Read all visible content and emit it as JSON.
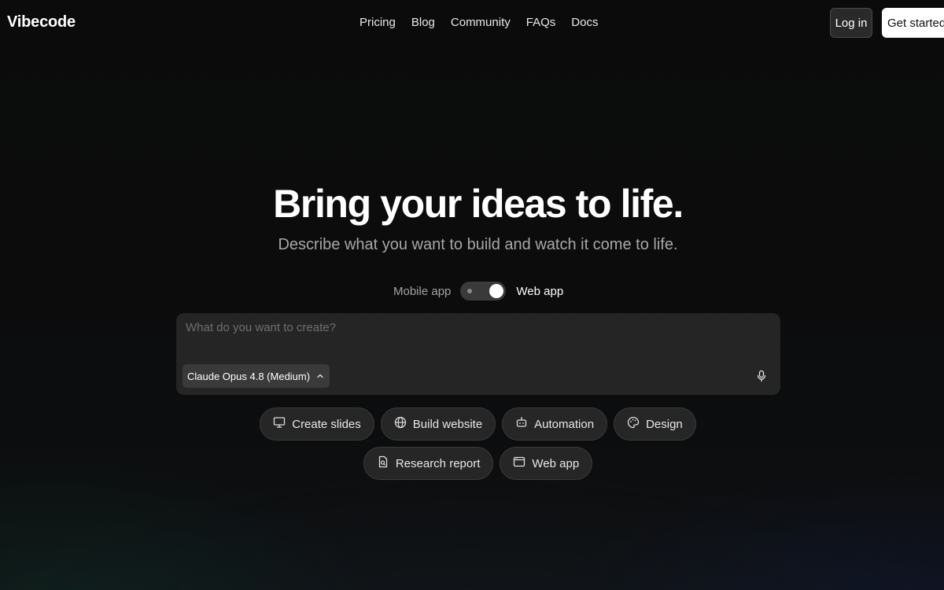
{
  "header": {
    "brand": "Vibecode",
    "nav": [
      "Pricing",
      "Blog",
      "Community",
      "FAQs",
      "Docs"
    ],
    "login_label": "Log in",
    "get_started_label": "Get started"
  },
  "hero": {
    "title": "Bring your ideas to life.",
    "subtitle": "Describe what you want to build and watch it come to life."
  },
  "mode_toggle": {
    "left_label": "Mobile app",
    "right_label": "Web app",
    "selected": "Web app"
  },
  "prompt": {
    "placeholder": "What do you want to create?",
    "value": "",
    "model": "Claude Opus 4.8 (Medium)",
    "model_icon": "chevron-up-icon",
    "mic_icon": "microphone-icon"
  },
  "chips": {
    "row1": [
      {
        "label": "Create slides",
        "icon": "presentation-icon"
      },
      {
        "label": "Build website",
        "icon": "globe-icon"
      },
      {
        "label": "Automation",
        "icon": "robot-icon"
      },
      {
        "label": "Design",
        "icon": "palette-icon"
      }
    ],
    "row2": [
      {
        "label": "Research report",
        "icon": "file-search-icon"
      },
      {
        "label": "Web app",
        "icon": "browser-window-icon"
      }
    ]
  },
  "colors": {
    "background": "#0b0b0b",
    "surface": "#252525",
    "chip_bg": "#262626",
    "primary_button": "#ffffff",
    "muted_text": "#a7a7a7"
  }
}
